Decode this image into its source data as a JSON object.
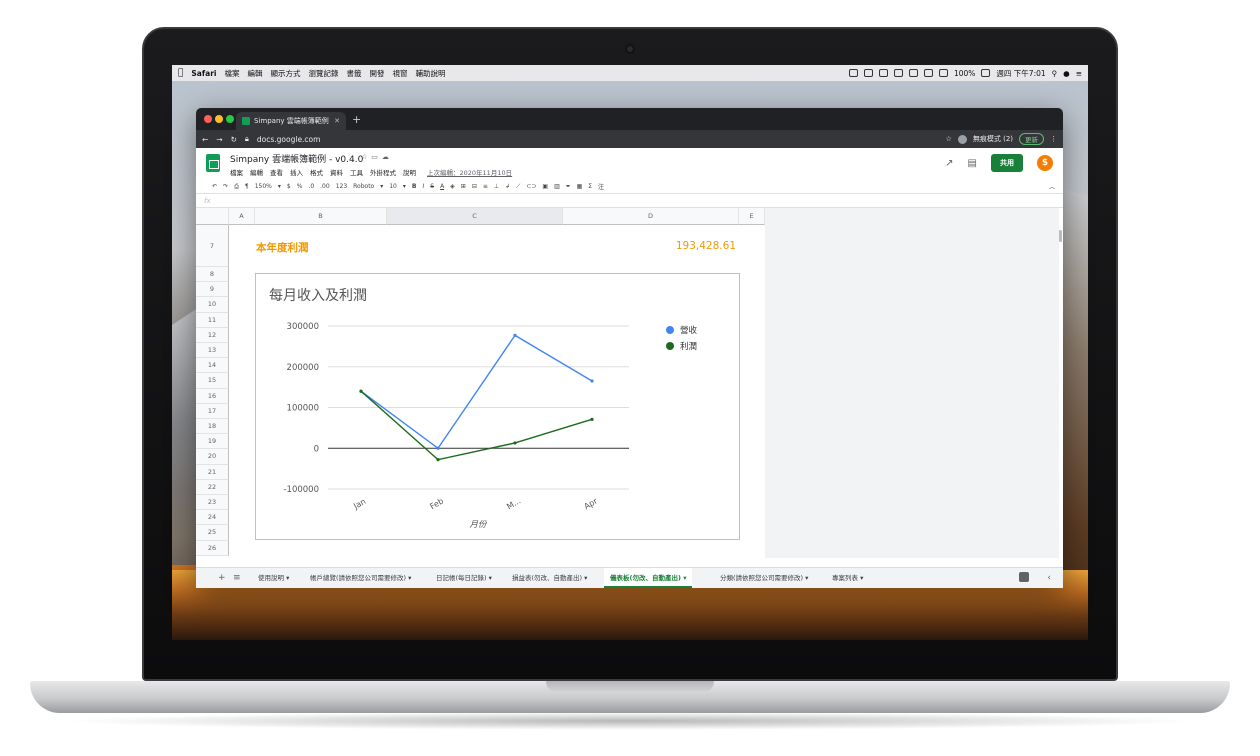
{
  "menubar": {
    "app": "Safari",
    "items": [
      "檔案",
      "編輯",
      "顯示方式",
      "瀏覽記錄",
      "書籤",
      "開發",
      "視窗",
      "輔助說明"
    ],
    "battery": "100%",
    "clock": "週四 下午7:01"
  },
  "browser": {
    "tab_title": "Simpany 雲端帳簿範例 - v0.4.0",
    "url": "docs.google.com",
    "profile": "無痕模式 (2)",
    "update_label": "更新"
  },
  "doc": {
    "title": "Simpany 雲端帳簿範例 - v0.4.0",
    "menus": [
      "檔案",
      "編輯",
      "查看",
      "插入",
      "格式",
      "資料",
      "工具",
      "外掛程式",
      "說明"
    ],
    "last_edit": "上次編輯：2020年11月10日",
    "share_label": "共用"
  },
  "toolbar": {
    "zoom": "150%",
    "currency": "$",
    "percent": "%",
    "decimals": ".0",
    "more_decimals": ".00",
    "number_format": "123",
    "font": "Roboto",
    "font_size": "10"
  },
  "formula_bar": {
    "fx": "fx"
  },
  "grid": {
    "columns": [
      "A",
      "B",
      "C",
      "D",
      "E"
    ],
    "rows": [
      "7",
      "8",
      "9",
      "10",
      "11",
      "12",
      "13",
      "14",
      "15",
      "16",
      "17",
      "18",
      "19",
      "20",
      "21",
      "22",
      "23",
      "24",
      "25",
      "26"
    ],
    "profit_label": "本年度利潤",
    "profit_value": "193,428.61"
  },
  "chart_data": {
    "type": "line",
    "title": "每月收入及利潤",
    "categories": [
      "Jan",
      "Feb",
      "M...",
      "Apr"
    ],
    "series": [
      {
        "name": "營收",
        "color": "#4285f4",
        "values": [
          140000,
          0,
          277000,
          165000
        ]
      },
      {
        "name": "利潤",
        "color": "#1e6b1e",
        "values": [
          140000,
          -28000,
          13000,
          71000
        ]
      }
    ],
    "xlabel": "月份",
    "ylabel": "",
    "ylim": [
      -100000,
      300000
    ],
    "yticks": [
      300000,
      200000,
      100000,
      0,
      -100000
    ],
    "ytick_labels": [
      "300000",
      "200000",
      "100000",
      "0",
      "-100000"
    ],
    "grid": true,
    "legend": "top-right"
  },
  "sheet_tabs": [
    {
      "label": "使用說明",
      "active": false
    },
    {
      "label": "帳戶總覽(請依照您公司需要修改)",
      "active": false
    },
    {
      "label": "日記帳(每日記錄)",
      "active": false
    },
    {
      "label": "損益表(勿改、自動產出)",
      "active": false
    },
    {
      "label": "儀表板(勿改、自動產出)",
      "active": true
    },
    {
      "label": "分類(請依照您公司需要修改)",
      "active": false
    },
    {
      "label": "專案列表",
      "active": false
    }
  ]
}
